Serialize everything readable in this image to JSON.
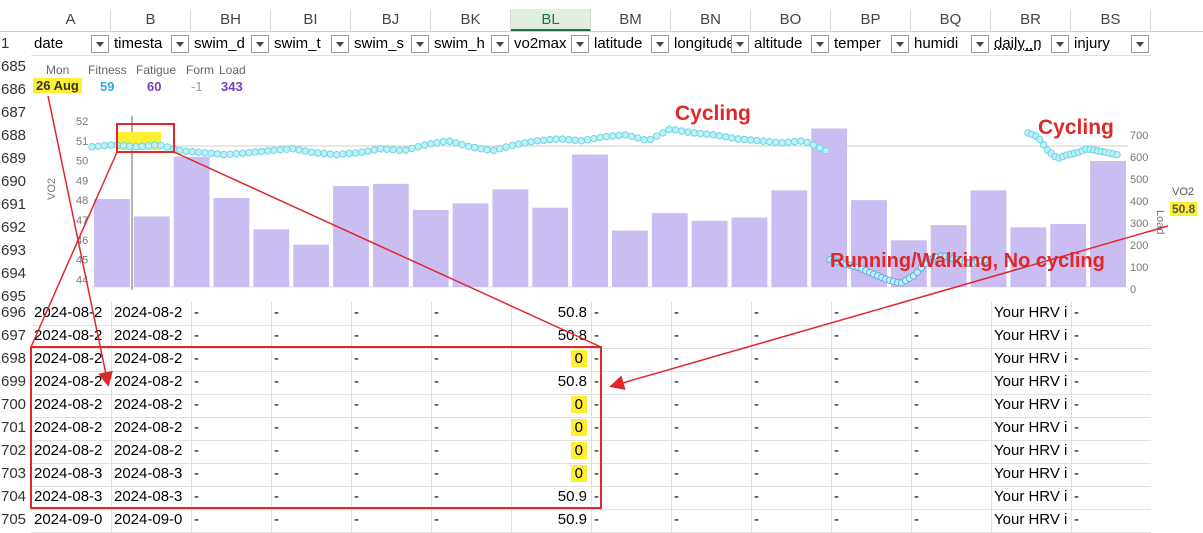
{
  "columns": [
    {
      "letter": "A",
      "field": "date"
    },
    {
      "letter": "B",
      "field": "timesta"
    },
    {
      "letter": "BH",
      "field": "swim_d"
    },
    {
      "letter": "BI",
      "field": "swim_t"
    },
    {
      "letter": "BJ",
      "field": "swim_s"
    },
    {
      "letter": "BK",
      "field": "swim_h"
    },
    {
      "letter": "BL",
      "field": "vo2max"
    },
    {
      "letter": "BM",
      "field": "latitude"
    },
    {
      "letter": "BN",
      "field": "longitude"
    },
    {
      "letter": "BO",
      "field": "altitude"
    },
    {
      "letter": "BP",
      "field": "temper"
    },
    {
      "letter": "BQ",
      "field": "humidi"
    },
    {
      "letter": "BR",
      "field": "daily_n"
    },
    {
      "letter": "BS",
      "field": "injury"
    }
  ],
  "header_row_number": "1",
  "chart_row_numbers": [
    "685",
    "686",
    "687",
    "688",
    "689",
    "690",
    "691",
    "692",
    "693",
    "694",
    "695"
  ],
  "stats": {
    "day": "Mon",
    "date": "26 Aug",
    "fitness_label": "Fitness",
    "fitness_value": "59",
    "fatigue_label": "Fatigue",
    "fatigue_value": "60",
    "form_label": "Form",
    "form_value": "-1",
    "load_label": "Load",
    "load_value": "343"
  },
  "annotations": {
    "cycling_1": "Cycling",
    "cycling_2": "Cycling",
    "running": "Running/Walking, No cycling"
  },
  "chart_side_labels": {
    "left_axis": "VO2",
    "right_axis": "Load",
    "hover_label": "VO2",
    "hover_value": "50.8"
  },
  "chart_data": {
    "type": "bar",
    "left_axis_ticks": [
      "52",
      "51",
      "50",
      "49",
      "48",
      "47",
      "46",
      "45",
      "44"
    ],
    "right_axis_ticks": [
      "700",
      "600",
      "500",
      "400",
      "300",
      "200",
      "100",
      "0"
    ],
    "load_values": [
      405,
      325,
      600,
      410,
      265,
      195,
      465,
      475,
      355,
      385,
      450,
      365,
      610,
      260,
      340,
      305,
      320,
      445,
      730,
      400,
      215,
      285,
      445,
      275,
      290,
      580
    ],
    "vo2_series": [
      {
        "segment": 1,
        "values": [
          50.7,
          50.8,
          50.7,
          50.8,
          50.5,
          50.4,
          50.3,
          50.4,
          50.5,
          50.6,
          50.4,
          50.3,
          50.4,
          50.6,
          50.5,
          50.8,
          51.0,
          50.7,
          50.5,
          50.8,
          51.0,
          51.1,
          51.0,
          51.2,
          51.3,
          51.0,
          51.6,
          51.4,
          51.3,
          51.1,
          51.0,
          50.9,
          51.0,
          50.5
        ]
      },
      {
        "segment": 2,
        "values": [
          45.0,
          44.8,
          44.6,
          44.3,
          44.0,
          43.8,
          44.2,
          45.0,
          45.2,
          45.0,
          44.8,
          45.0
        ]
      },
      {
        "segment": 3,
        "values": [
          51.4,
          51.2,
          50.5,
          50.1,
          50.3,
          50.4,
          50.6,
          50.5,
          50.4,
          50.3
        ]
      }
    ]
  },
  "rows": [
    {
      "num": "696",
      "a": "2024-08-2",
      "b": "2024-08-2",
      "bh": "-",
      "bi": "-",
      "bj": "-",
      "bk": "-",
      "bl": "50.8",
      "bm": "-",
      "bn": "-",
      "bo": "-",
      "bp": "-",
      "bq": "-",
      "br": "Your HRV i",
      "bs": "-"
    },
    {
      "num": "697",
      "a": "2024-08-2",
      "b": "2024-08-2",
      "bh": "-",
      "bi": "-",
      "bj": "-",
      "bk": "-",
      "bl": "50.8",
      "bm": "-",
      "bn": "-",
      "bo": "-",
      "bp": "-",
      "bq": "-",
      "br": "Your HRV i",
      "bs": "-"
    },
    {
      "num": "698",
      "a": "2024-08-2",
      "b": "2024-08-2",
      "bh": "-",
      "bi": "-",
      "bj": "-",
      "bk": "-",
      "bl": "0",
      "bm": "-",
      "bn": "-",
      "bo": "-",
      "bp": "-",
      "bq": "-",
      "br": "Your HRV i",
      "bs": "-"
    },
    {
      "num": "699",
      "a": "2024-08-2",
      "b": "2024-08-2",
      "bh": "-",
      "bi": "-",
      "bj": "-",
      "bk": "-",
      "bl": "50.8",
      "bm": "-",
      "bn": "-",
      "bo": "-",
      "bp": "-",
      "bq": "-",
      "br": "Your HRV i",
      "bs": "-"
    },
    {
      "num": "700",
      "a": "2024-08-2",
      "b": "2024-08-2",
      "bh": "-",
      "bi": "-",
      "bj": "-",
      "bk": "-",
      "bl": "0",
      "bm": "-",
      "bn": "-",
      "bo": "-",
      "bp": "-",
      "bq": "-",
      "br": "Your HRV i",
      "bs": "-"
    },
    {
      "num": "701",
      "a": "2024-08-2",
      "b": "2024-08-2",
      "bh": "-",
      "bi": "-",
      "bj": "-",
      "bk": "-",
      "bl": "0",
      "bm": "-",
      "bn": "-",
      "bo": "-",
      "bp": "-",
      "bq": "-",
      "br": "Your HRV i",
      "bs": "-"
    },
    {
      "num": "702",
      "a": "2024-08-2",
      "b": "2024-08-2",
      "bh": "-",
      "bi": "-",
      "bj": "-",
      "bk": "-",
      "bl": "0",
      "bm": "-",
      "bn": "-",
      "bo": "-",
      "bp": "-",
      "bq": "-",
      "br": "Your HRV i",
      "bs": "-"
    },
    {
      "num": "703",
      "a": "2024-08-3",
      "b": "2024-08-3",
      "bh": "-",
      "bi": "-",
      "bj": "-",
      "bk": "-",
      "bl": "0",
      "bm": "-",
      "bn": "-",
      "bo": "-",
      "bp": "-",
      "bq": "-",
      "br": "Your HRV i",
      "bs": "-"
    },
    {
      "num": "704",
      "a": "2024-08-3",
      "b": "2024-08-3",
      "bh": "-",
      "bi": "-",
      "bj": "-",
      "bk": "-",
      "bl": "50.9",
      "bm": "-",
      "bn": "-",
      "bo": "-",
      "bp": "-",
      "bq": "-",
      "br": "Your HRV i",
      "bs": "-"
    },
    {
      "num": "705",
      "a": "2024-09-0",
      "b": "2024-09-0",
      "bh": "-",
      "bi": "-",
      "bj": "-",
      "bk": "-",
      "bl": "50.9",
      "bm": "-",
      "bn": "-",
      "bo": "-",
      "bp": "-",
      "bq": "-",
      "br": "Your HRV i",
      "bs": "-"
    }
  ],
  "colors": {
    "bar": "#c9bdf2",
    "dot": "#6fd5e6",
    "dot_run": "#6aaee0",
    "annotation": "#e0282a",
    "highlight": "#ffef33",
    "fitness": "#3aa8d8",
    "fatigue": "#7a3fc0",
    "load": "#7a3fc0"
  }
}
